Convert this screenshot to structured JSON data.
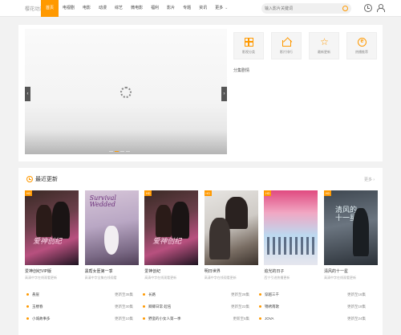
{
  "header": {
    "logo": "樱花动漫",
    "nav": [
      "首页",
      "电视剧",
      "电影",
      "动漫",
      "综艺",
      "微电影",
      "福利",
      "影片",
      "专题",
      "资讯"
    ],
    "more_label": "更多",
    "search_placeholder": "输入影片关键词"
  },
  "banner": {
    "caption": "",
    "prev": "‹",
    "next": "›",
    "quick_links": [
      {
        "icon": "grid-icon",
        "label": "影视分类"
      },
      {
        "icon": "house-icon",
        "label": "影片排行"
      },
      {
        "icon": "star-icon",
        "label": "最新更新"
      },
      {
        "icon": "e-icon",
        "label": "热播推荐"
      }
    ],
    "section_tag": "分集剧情"
  },
  "latest": {
    "title": "最近更新",
    "more": "更多 ›",
    "cards": [
      {
        "tag": "HD",
        "title": "爱神创纪VIP版",
        "sub": "高清中字在线观看更新"
      },
      {
        "tag": "",
        "title": "黑帮女匪第一季",
        "sub": "高清中字全集在线观看"
      },
      {
        "tag": "HD",
        "title": "爱神创纪",
        "sub": "高清中字在线观看更新"
      },
      {
        "tag": "HD",
        "title": "明日世界",
        "sub": "高清中字在线观看更新"
      },
      {
        "tag": "HD",
        "title": "追光的日子",
        "sub": "西宁引进热播更新"
      },
      {
        "tag": "HD",
        "title": "清风的十一星",
        "sub": "高清中字在线观看更新"
      }
    ],
    "episodes": [
      {
        "name": "悬崖",
        "status": "更新至35集"
      },
      {
        "name": "长路",
        "status": "更新至28集"
      },
      {
        "name": "穿越三千",
        "status": "更新至16集"
      },
      {
        "name": "玉楼春",
        "status": "更新至30集"
      },
      {
        "name": "卿卿日常·起名",
        "status": "更新至22集"
      },
      {
        "name": "锦绣南歌",
        "status": "更新至18集"
      },
      {
        "name": "小城故事多",
        "status": "更新至10集"
      },
      {
        "name": "野蛮的小女人第一季",
        "status": "更新至5集"
      },
      {
        "name": "JOVA",
        "status": "更新至24集"
      }
    ]
  },
  "colors": {
    "accent": "#ff9900",
    "header_bg": "#ffffff",
    "page_bg": "#f2f2f2"
  }
}
